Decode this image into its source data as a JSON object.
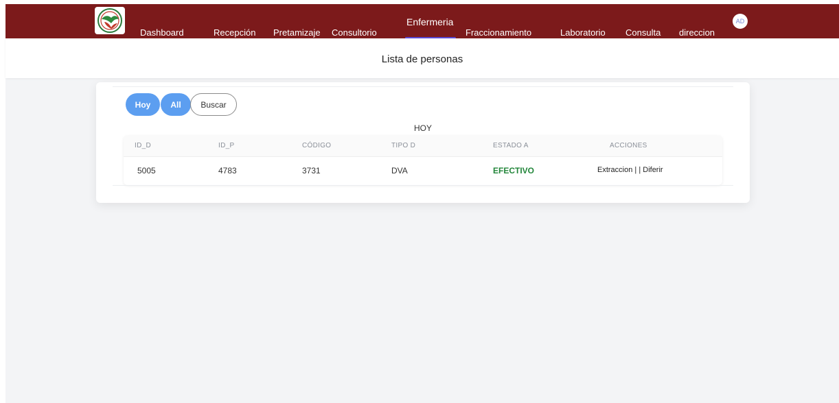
{
  "navbar": {
    "items": [
      {
        "label": "Dashboard"
      },
      {
        "label": "Recepción"
      },
      {
        "label": "Pretamizaje"
      },
      {
        "label": "Consultorio"
      },
      {
        "label": "Enfermeria"
      },
      {
        "label": "Fraccionamiento"
      },
      {
        "label": "Laboratorio"
      },
      {
        "label": "Consulta"
      },
      {
        "label": "direccion"
      }
    ],
    "active": "Enfermeria",
    "avatar_initials": "AD"
  },
  "page": {
    "title": "Lista de personas"
  },
  "filters": {
    "today_label": "Hoy",
    "all_label": "All",
    "search_label": "Buscar"
  },
  "table": {
    "title": "HOY",
    "columns": [
      "ID_D",
      "ID_P",
      "CÓDIGO",
      "TIPO D",
      "ESTADO A",
      "ACCIONES"
    ],
    "rows": [
      {
        "id_d": "5005",
        "id_p": "4783",
        "codigo": "3731",
        "tipo_d": "DVA",
        "estado_a": "EFECTIVO",
        "action_extract": "Extraccion",
        "separator": " | | ",
        "action_defer": "Diferir"
      }
    ]
  },
  "colors": {
    "navbar_bg": "#7c1a1b",
    "active_underline": "#5b4bd6",
    "button_blue": "#5c9ef0",
    "status_green": "#22863a"
  },
  "icons": {
    "logo": "organization-logo"
  }
}
